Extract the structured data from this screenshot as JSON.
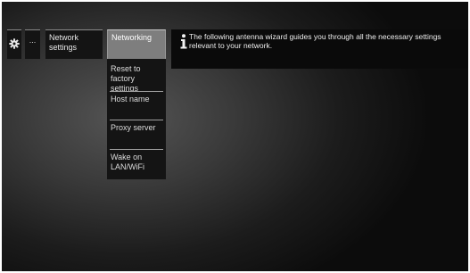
{
  "breadcrumb": {
    "settings_icon": "gear-icon",
    "more_label": "...",
    "network_settings_label": "Network settings"
  },
  "submenu": {
    "items": [
      {
        "label": "Networking",
        "selected": true
      },
      {
        "label": "Reset to factory settings",
        "selected": false
      },
      {
        "label": "Host name",
        "selected": false
      },
      {
        "label": "Proxy server",
        "selected": false
      },
      {
        "label": "Wake on LAN/WiFi",
        "selected": false
      }
    ]
  },
  "info": {
    "icon": "info-icon",
    "text": "The following antenna wizard guides you through all the necessary settings relevant to your network."
  },
  "colors": {
    "selected_item_bg": "#7e7e7e",
    "panel_bg": "#141414",
    "text": "#e8e8e8"
  }
}
